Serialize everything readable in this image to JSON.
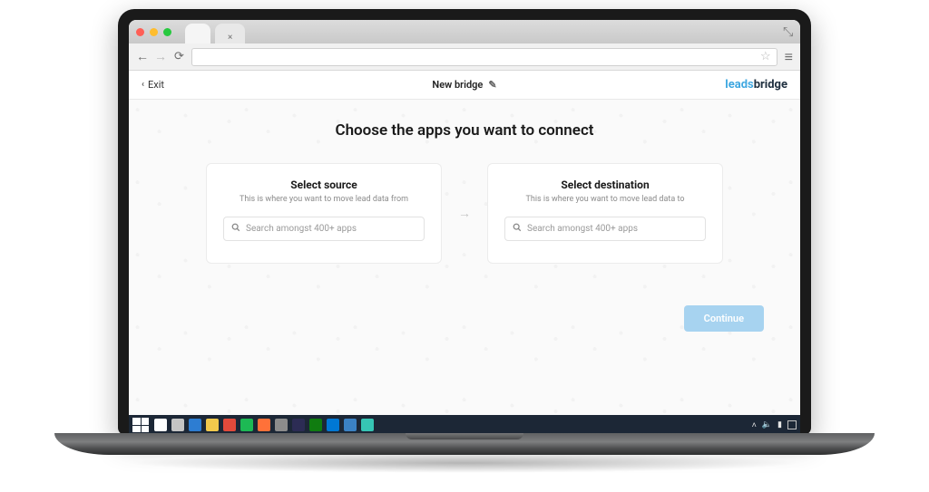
{
  "browser": {
    "tab_close": "×",
    "star_label": "Bookmark",
    "menu_label": "Menu"
  },
  "header": {
    "exit_label": "Exit",
    "title": "New bridge",
    "logo_leads": "leads",
    "logo_bridge": "bridge"
  },
  "main": {
    "heading": "Choose the apps you want to connect",
    "source": {
      "title": "Select source",
      "subtitle": "This is where you want to move lead data from",
      "placeholder": "Search amongst 400+ apps"
    },
    "destination": {
      "title": "Select destination",
      "subtitle": "This is where you want to move lead data to",
      "placeholder": "Search amongst 400+ apps"
    },
    "continue_label": "Continue"
  },
  "taskbar": {
    "icons": [
      {
        "name": "search",
        "color": "#ffffff"
      },
      {
        "name": "task-view",
        "color": "#c4c4c4"
      },
      {
        "name": "mail",
        "color": "#2d7dd2"
      },
      {
        "name": "explorer",
        "color": "#f2c94c"
      },
      {
        "name": "chrome",
        "color": "#e24a3b"
      },
      {
        "name": "spotify",
        "color": "#1db954"
      },
      {
        "name": "firefox",
        "color": "#ff7139"
      },
      {
        "name": "settings",
        "color": "#8c8c8c"
      },
      {
        "name": "eclipse",
        "color": "#2c2c54"
      },
      {
        "name": "xbox",
        "color": "#107c10"
      },
      {
        "name": "vscode",
        "color": "#0078d4"
      },
      {
        "name": "store",
        "color": "#3b82c4"
      },
      {
        "name": "edge",
        "color": "#36c5b4"
      }
    ]
  }
}
